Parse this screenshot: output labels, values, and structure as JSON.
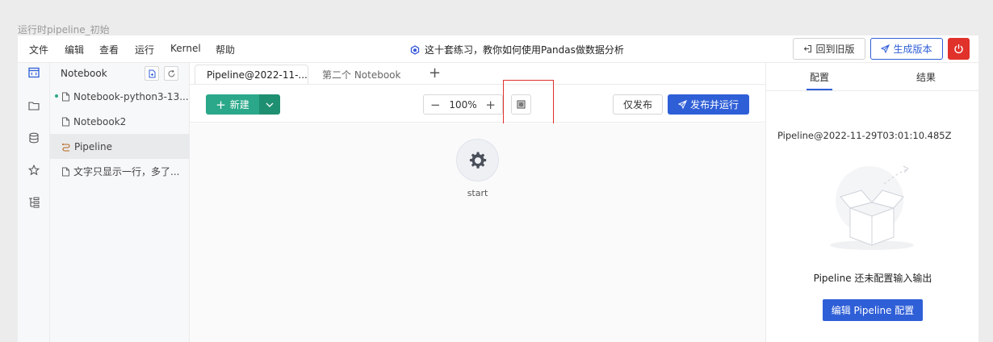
{
  "caption": "运行时pipeline_初始",
  "menubar": {
    "items": [
      "文件",
      "编辑",
      "查看",
      "运行",
      "Kernel",
      "帮助"
    ],
    "title": "这十套练习，教你如何使用Pandas做数据分析",
    "back_label": "回到旧版",
    "generate_label": "生成版本"
  },
  "filepanel": {
    "title": "Notebook",
    "items": [
      "Notebook-python3-13...",
      "Notebook2",
      "Pipeline",
      "文字只显示一行，多了..."
    ]
  },
  "tabs": {
    "active": "Pipeline@2022-11-...",
    "inactive": "第二个 Notebook",
    "add": "+"
  },
  "toolbar": {
    "new_label": "新建",
    "zoom": "100%",
    "zoom_minus": "−",
    "zoom_plus": "+",
    "publish_label": "仅发布",
    "publish_run_label": "发布并运行"
  },
  "canvas": {
    "node_label": "start"
  },
  "rightpanel": {
    "tab_config": "配置",
    "tab_result": "结果",
    "pipeline_name": "Pipeline@2022-11-29T03:01:10.485Z",
    "empty_text": "Pipeline 还未配置输入输出",
    "edit_button": "编辑 Pipeline 配置"
  },
  "colors": {
    "accent_blue": "#2f5fd7",
    "accent_green": "#2aa889",
    "danger_red": "#e0312b"
  }
}
